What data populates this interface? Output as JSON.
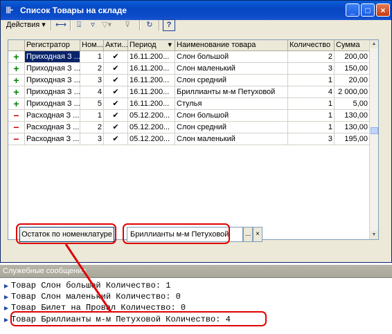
{
  "window": {
    "title": "Список Товары на складе",
    "controls": [
      "_",
      "□",
      "×"
    ]
  },
  "toolbar": {
    "actions_label": "Действия",
    "actions_arrow": "▾",
    "icons": [
      "sync-icon",
      "filter-icon",
      "filter-set-icon",
      "filter-off-icon",
      "clear-filter-icon",
      "refresh-icon",
      "help-icon"
    ]
  },
  "table": {
    "columns": [
      "Регистратор",
      "Ном...",
      "Акти...",
      "Период",
      "Наименование товара",
      "Количество",
      "Сумма"
    ],
    "sort_indicator": "▾",
    "rows": [
      {
        "mark": "+",
        "registrar": "Приходная З ...",
        "num": "1",
        "active": "✔",
        "period": "16.11.200...",
        "name": "Слон большой",
        "qty": "2",
        "sum": "200,00"
      },
      {
        "mark": "+",
        "registrar": "Приходная З ...",
        "num": "2",
        "active": "✔",
        "period": "16.11.200...",
        "name": "Слон маленький",
        "qty": "3",
        "sum": "150,00"
      },
      {
        "mark": "+",
        "registrar": "Приходная З ...",
        "num": "3",
        "active": "✔",
        "period": "16.11.200...",
        "name": "Слон средний",
        "qty": "1",
        "sum": "20,00"
      },
      {
        "mark": "+",
        "registrar": "Приходная З ...",
        "num": "4",
        "active": "✔",
        "period": "16.11.200...",
        "name": "Бриллианты м-м Петуховой",
        "qty": "4",
        "sum": "2 000,00"
      },
      {
        "mark": "+",
        "registrar": "Приходная З ...",
        "num": "5",
        "active": "✔",
        "period": "16.11.200...",
        "name": "Стулья",
        "qty": "1",
        "sum": "5,00"
      },
      {
        "mark": "−",
        "registrar": "Расходная З ...",
        "num": "1",
        "active": "✔",
        "period": "05.12.200...",
        "name": "Слон большой",
        "qty": "1",
        "sum": "130,00"
      },
      {
        "mark": "−",
        "registrar": "Расходная З ...",
        "num": "2",
        "active": "✔",
        "period": "05.12.200...",
        "name": "Слон средний",
        "qty": "1",
        "sum": "130,00"
      },
      {
        "mark": "−",
        "registrar": "Расходная З ...",
        "num": "3",
        "active": "✔",
        "period": "05.12.200...",
        "name": "Слон маленький",
        "qty": "3",
        "sum": "195,00"
      }
    ]
  },
  "form": {
    "button_label": "Остаток по номенклатуре",
    "field_value": "Бриллианты м-м Петуховой",
    "select_button": "...",
    "clear_button": "×"
  },
  "messages": {
    "title": "Служебные сообщения",
    "lines": [
      "Товар Слон большой Количество: 1",
      "Товар Слон маленький Количество: 0",
      "Товар Билет на Провал Количество: 0",
      "Товар Бриллианты м-м Петуховой Количество: 4"
    ]
  },
  "highlight_color": "#e00000",
  "positive_color": "#008000",
  "negative_color": "#cc0000"
}
